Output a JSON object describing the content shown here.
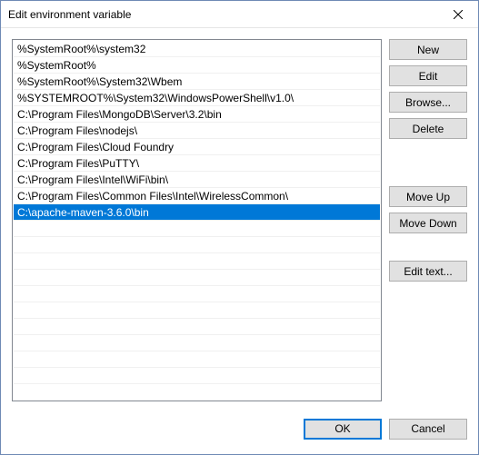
{
  "title": "Edit environment variable",
  "items": [
    "%SystemRoot%\\system32",
    "%SystemRoot%",
    "%SystemRoot%\\System32\\Wbem",
    "%SYSTEMROOT%\\System32\\WindowsPowerShell\\v1.0\\",
    "C:\\Program Files\\MongoDB\\Server\\3.2\\bin",
    "C:\\Program Files\\nodejs\\",
    "C:\\Program Files\\Cloud Foundry",
    "C:\\Program Files\\PuTTY\\",
    "C:\\Program Files\\Intel\\WiFi\\bin\\",
    "C:\\Program Files\\Common Files\\Intel\\WirelessCommon\\",
    "C:\\apache-maven-3.6.0\\bin"
  ],
  "selected_index": 10,
  "buttons": {
    "new": "New",
    "edit": "Edit",
    "browse": "Browse...",
    "delete": "Delete",
    "move_up": "Move Up",
    "move_down": "Move Down",
    "edit_text": "Edit text...",
    "ok": "OK",
    "cancel": "Cancel"
  }
}
